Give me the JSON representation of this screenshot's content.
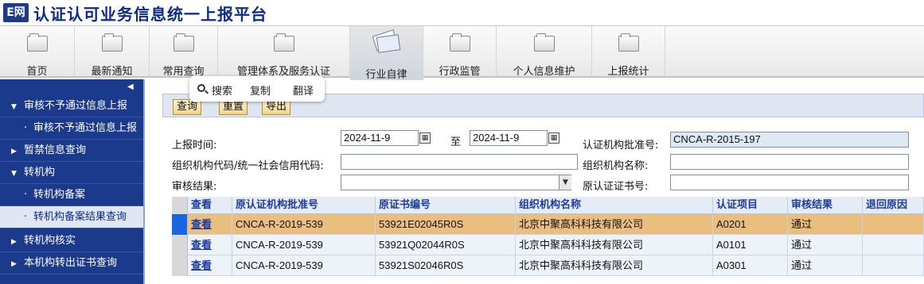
{
  "app": {
    "logo_text": "E网",
    "title": "认证认可业务信息统一上报平台"
  },
  "nav": {
    "items": [
      {
        "label": "首页"
      },
      {
        "label": "最新通知"
      },
      {
        "label": "常用查询"
      },
      {
        "label": "管理体系及服务认证"
      },
      {
        "label": "行业自律"
      },
      {
        "label": "行政监管"
      },
      {
        "label": "个人信息维护"
      },
      {
        "label": "上报统计"
      }
    ]
  },
  "popup": {
    "search": "搜索",
    "copy": "复制",
    "translate": "翻译"
  },
  "sidebar": {
    "items": [
      {
        "label": "审核不予通过信息上报"
      },
      {
        "label": "审核不予通过信息上报"
      },
      {
        "label": "暂禁信息查询"
      },
      {
        "label": "转机构"
      },
      {
        "label": "转机构备案"
      },
      {
        "label": "转机构备案结果查询"
      },
      {
        "label": "转机构核实"
      },
      {
        "label": "本机构转出证书查询"
      }
    ]
  },
  "toolbar": {
    "query": "查询",
    "reset": "重置",
    "export": "导出"
  },
  "form": {
    "report_time_label": "上报时间:",
    "date_from": "2024-11-9",
    "to_label": "至",
    "date_to": "2024-11-9",
    "approval_no_label": "认证机构批准号:",
    "approval_no": "CNCA-R-2015-197",
    "org_code_label": "组织机构代码/统一社会信用代码:",
    "org_code": "",
    "org_name_label": "组织机构名称:",
    "org_name": "",
    "result_label": "审核结果:",
    "result": "",
    "orig_cert_label": "原认证证书号:",
    "orig_cert": ""
  },
  "table": {
    "headers": [
      "查看",
      "原认证机构批准号",
      "原证书编号",
      "组织机构名称",
      "认证项目",
      "审核结果",
      "退回原因"
    ],
    "rows": [
      {
        "view": "查看",
        "approval": "CNCA-R-2019-539",
        "cert": "53921E02045R0S",
        "org": "北京中聚高科科技有限公司",
        "project": "A0201",
        "result": "通过",
        "reason": ""
      },
      {
        "view": "查看",
        "approval": "CNCA-R-2019-539",
        "cert": "53921Q02044R0S",
        "org": "北京中聚高科科技有限公司",
        "project": "A0101",
        "result": "通过",
        "reason": ""
      },
      {
        "view": "查看",
        "approval": "CNCA-R-2019-539",
        "cert": "53921S02046R0S",
        "org": "北京中聚高科科技有限公司",
        "project": "A0301",
        "result": "通过",
        "reason": ""
      }
    ]
  },
  "colors": {
    "brand": "#1c3a8c",
    "title": "#0d2b8a",
    "selected_row": "#e9be7f",
    "link": "#1a3aa0"
  }
}
